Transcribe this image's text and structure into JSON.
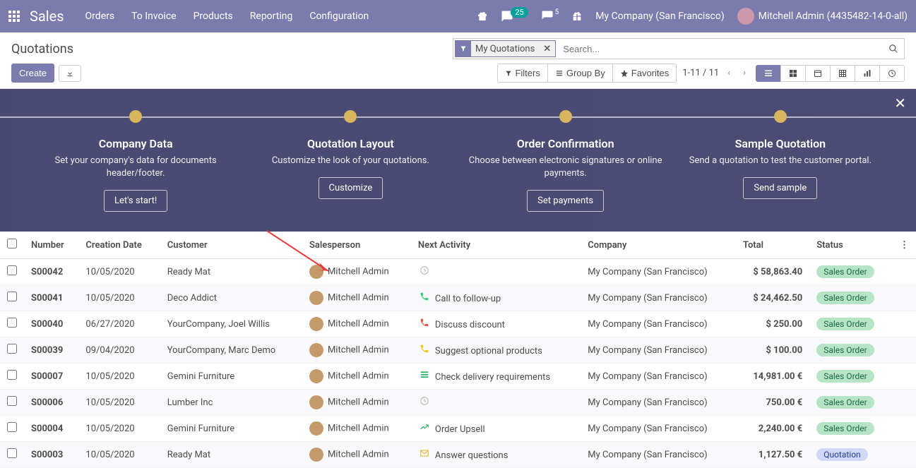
{
  "nav": {
    "brand": "Sales",
    "menu": [
      "Orders",
      "To Invoice",
      "Products",
      "Reporting",
      "Configuration"
    ],
    "badge_messages": "25",
    "badge_activities": "5",
    "company": "My Company (San Francisco)",
    "user": "Mitchell Admin (4435482-14-0-all)"
  },
  "cp": {
    "title": "Quotations",
    "create": "Create",
    "facet": "My Quotations",
    "search_placeholder": "Search...",
    "filters": "Filters",
    "groupby": "Group By",
    "favorites": "Favorites",
    "pager": "1-11 / 11"
  },
  "onboard": {
    "steps": [
      {
        "title": "Company Data",
        "desc": "Set your company's data for documents header/footer.",
        "btn": "Let's start!"
      },
      {
        "title": "Quotation Layout",
        "desc": "Customize the look of your quotations.",
        "btn": "Customize"
      },
      {
        "title": "Order Confirmation",
        "desc": "Choose between electronic signatures or online payments.",
        "btn": "Set payments"
      },
      {
        "title": "Sample Quotation",
        "desc": "Send a quotation to test the customer portal.",
        "btn": "Send sample"
      }
    ]
  },
  "table": {
    "headers": {
      "number": "Number",
      "date": "Creation Date",
      "customer": "Customer",
      "salesperson": "Salesperson",
      "activity": "Next Activity",
      "company": "Company",
      "total": "Total",
      "status": "Status"
    },
    "rows": [
      {
        "number": "S00042",
        "date": "10/05/2020",
        "customer": "Ready Mat",
        "salesperson": "Mitchell Admin",
        "activity": "",
        "activity_icon": "clock",
        "company": "My Company (San Francisco)",
        "total": "$ 58,863.40",
        "status": "Sales Order",
        "status_kind": "green"
      },
      {
        "number": "S00041",
        "date": "10/05/2020",
        "customer": "Deco Addict",
        "salesperson": "Mitchell Admin",
        "activity": "Call to follow-up",
        "activity_icon": "phone-g",
        "company": "My Company (San Francisco)",
        "total": "$ 24,462.50",
        "status": "Sales Order",
        "status_kind": "green"
      },
      {
        "number": "S00040",
        "date": "06/27/2020",
        "customer": "YourCompany, Joel Willis",
        "salesperson": "Mitchell Admin",
        "activity": "Discuss discount",
        "activity_icon": "phone-r",
        "company": "My Company (San Francisco)",
        "total": "$ 250.00",
        "status": "Sales Order",
        "status_kind": "green"
      },
      {
        "number": "S00039",
        "date": "09/04/2020",
        "customer": "YourCompany, Marc Demo",
        "salesperson": "Mitchell Admin",
        "activity": "Suggest optional products",
        "activity_icon": "phone-y",
        "company": "My Company (San Francisco)",
        "total": "$ 100.00",
        "status": "Sales Order",
        "status_kind": "green"
      },
      {
        "number": "S00007",
        "date": "10/05/2020",
        "customer": "Gemini Furniture",
        "salesperson": "Mitchell Admin",
        "activity": "Check delivery requirements",
        "activity_icon": "list",
        "company": "My Company (San Francisco)",
        "total": "14,981.00 €",
        "status": "Sales Order",
        "status_kind": "green"
      },
      {
        "number": "S00006",
        "date": "10/05/2020",
        "customer": "Lumber Inc",
        "salesperson": "Mitchell Admin",
        "activity": "",
        "activity_icon": "clock",
        "company": "My Company (San Francisco)",
        "total": "750.00 €",
        "status": "Sales Order",
        "status_kind": "green"
      },
      {
        "number": "S00004",
        "date": "10/05/2020",
        "customer": "Gemini Furniture",
        "salesperson": "Mitchell Admin",
        "activity": "Order Upsell",
        "activity_icon": "chart",
        "company": "My Company (San Francisco)",
        "total": "2,240.00 €",
        "status": "Sales Order",
        "status_kind": "green"
      },
      {
        "number": "S00003",
        "date": "10/05/2020",
        "customer": "Ready Mat",
        "salesperson": "Mitchell Admin",
        "activity": "Answer questions",
        "activity_icon": "mail",
        "company": "My Company (San Francisco)",
        "total": "1,127.50 €",
        "status": "Quotation",
        "status_kind": "blue"
      }
    ]
  }
}
